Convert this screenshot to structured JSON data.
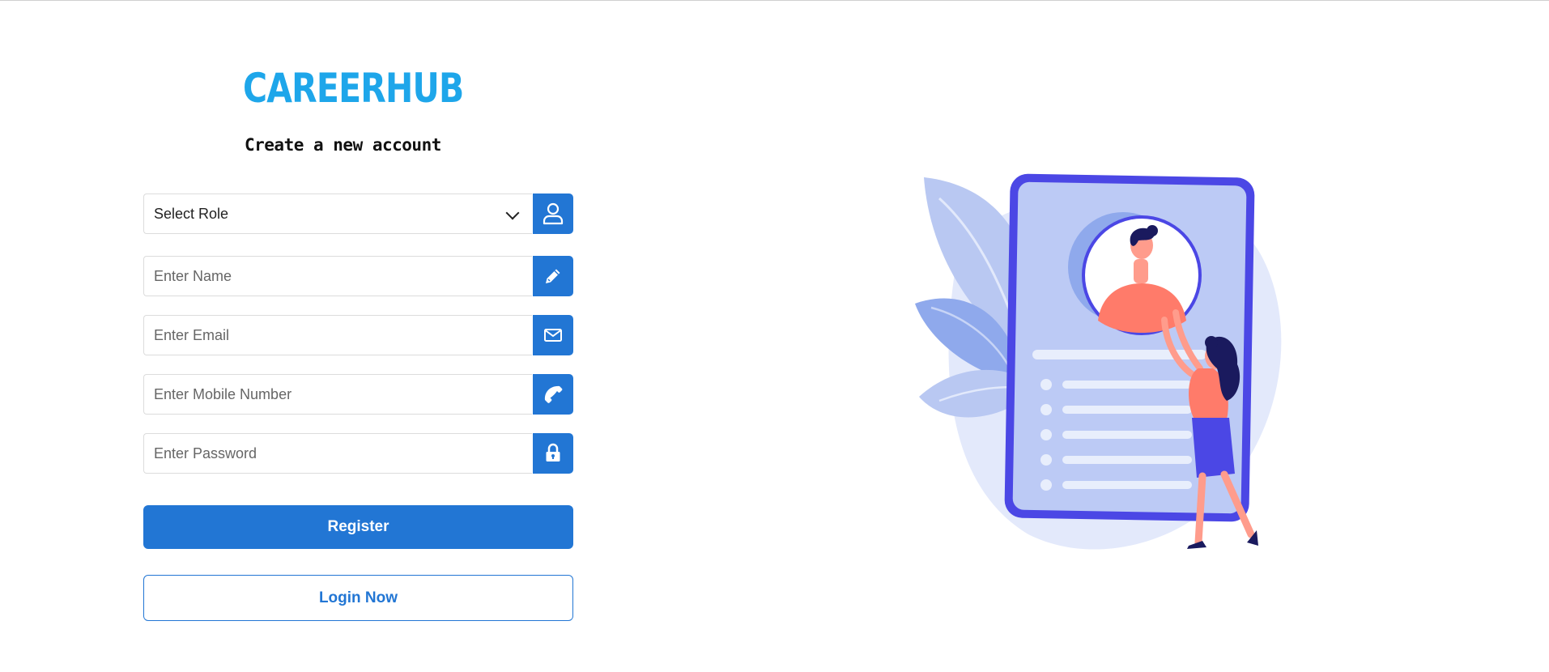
{
  "brand": {
    "name": "CAREERHUB",
    "color": "#1ea6ea"
  },
  "form": {
    "title": "Create a new account",
    "role_select": {
      "value": "Select Role",
      "icon": "user-icon"
    },
    "name_field": {
      "placeholder": "Enter Name",
      "icon": "pencil-icon"
    },
    "email_field": {
      "placeholder": "Enter Email",
      "icon": "envelope-icon"
    },
    "mobile_field": {
      "placeholder": "Enter Mobile Number",
      "icon": "phone-icon"
    },
    "password_field": {
      "placeholder": "Enter Password",
      "icon": "lock-icon"
    },
    "register_label": "Register",
    "login_label": "Login Now",
    "accent_color": "#2276d4"
  },
  "illustration": {
    "name": "profile-card-illustration"
  }
}
